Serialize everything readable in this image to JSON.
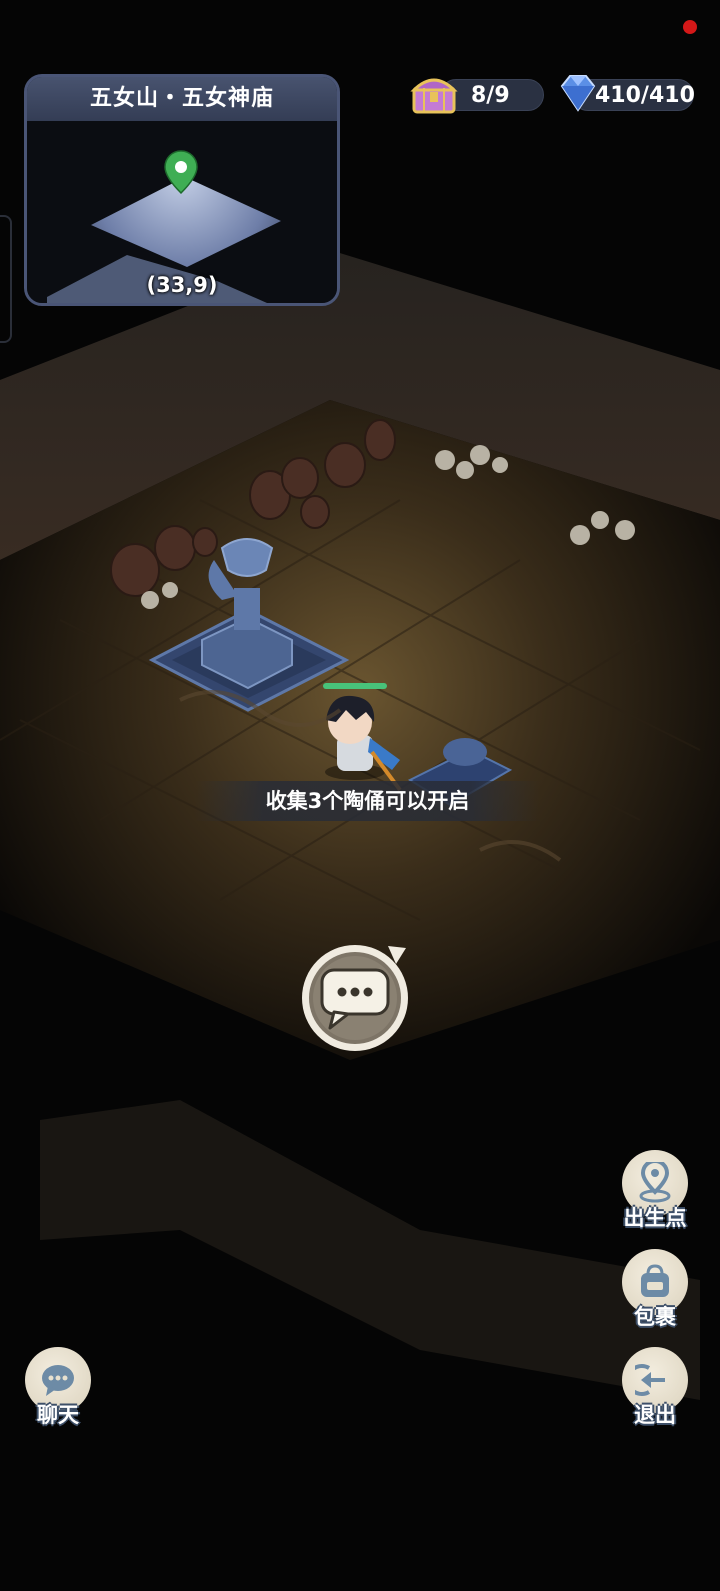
{
  "location": {
    "title": "五女山・五女神庙",
    "coords": "(33,9)"
  },
  "resources": {
    "chest_count": "8/9",
    "energy": "410/410"
  },
  "hint_text": "收集3个陶俑可以开启",
  "buttons": {
    "spawn": "出生点",
    "bag": "包裹",
    "exit": "退出",
    "chat": "聊天"
  },
  "icons": {
    "location": "map-pin-icon",
    "chest": "treasure-chest-icon",
    "energy": "blue-gem-icon",
    "dialog": "speech-bubble-icon",
    "spawn": "pin-icon",
    "bag": "backpack-icon",
    "exit": "exit-arrow-icon",
    "chat": "chat-bubble-icon"
  },
  "colors": {
    "minimap_border": "#4a5576",
    "health_bar": "#48c27a",
    "notification": "#d41818",
    "button_face": "#e8e1cf",
    "icon_blue": "#6d8ba6"
  }
}
